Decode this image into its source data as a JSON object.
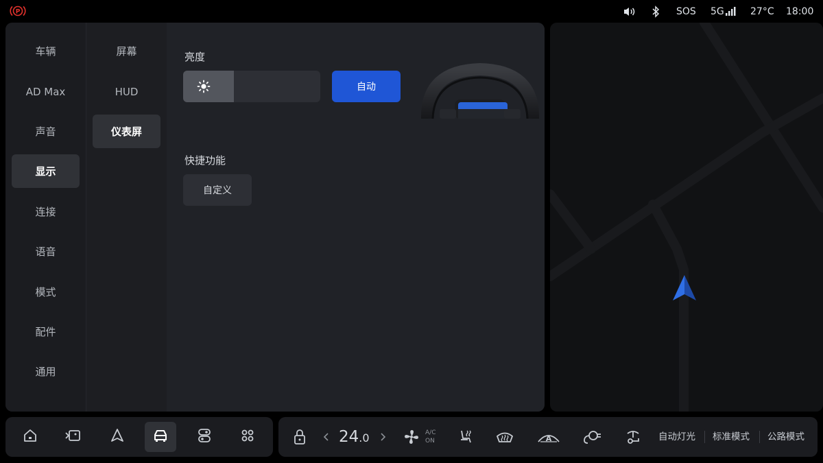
{
  "status_bar": {
    "sos": "SOS",
    "network": "5G",
    "temperature": "27°C",
    "time": "18:00"
  },
  "nav_primary": [
    {
      "label": "车辆"
    },
    {
      "label": "AD Max"
    },
    {
      "label": "声音"
    },
    {
      "label": "显示",
      "active": true
    },
    {
      "label": "连接"
    },
    {
      "label": "语音"
    },
    {
      "label": "模式"
    },
    {
      "label": "配件"
    },
    {
      "label": "通用"
    }
  ],
  "nav_secondary": [
    {
      "label": "屏幕"
    },
    {
      "label": "HUD"
    },
    {
      "label": "仪表屏",
      "active": true
    }
  ],
  "content": {
    "brightness_title": "亮度",
    "brightness_level": 0.37,
    "auto_label": "自动",
    "shortcut_title": "快捷功能",
    "custom_label": "自定义"
  },
  "dock": {
    "apps": [
      {
        "icon": "home-icon"
      },
      {
        "icon": "media-icon"
      },
      {
        "icon": "navigation-icon"
      },
      {
        "icon": "car-icon",
        "active": true
      },
      {
        "icon": "toggle-icon"
      },
      {
        "icon": "apps-grid-icon"
      }
    ],
    "climate": {
      "temp_int": "24",
      "temp_dec": ".0",
      "ac_label": "A/C",
      "ac_state": "ON"
    },
    "auto_light": "自动灯光",
    "drive_mode": "标准模式",
    "road_mode": "公路模式"
  },
  "colors": {
    "accent": "#1f56d6",
    "parking_brake": "#e5322d",
    "nav_arrow": "#2f6fe6"
  }
}
